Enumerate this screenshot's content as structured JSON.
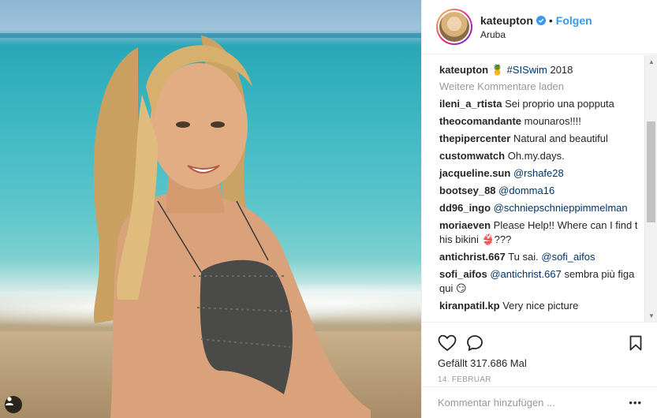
{
  "post": {
    "username": "kateupton",
    "separator": "•",
    "follow_label": "Folgen",
    "location": "Aruba",
    "caption": {
      "emoji": "🍍",
      "hashtag": "#SISwim",
      "text": " 2018"
    },
    "load_more_label": "Weitere Kommentare laden",
    "comments": [
      {
        "user": "ileni_a_rtista",
        "text": "Sei proprio una popputa"
      },
      {
        "user": "theocomandante",
        "text": "mounaros!!!!"
      },
      {
        "user": "thepipercenter",
        "text": "Natural and beautiful"
      },
      {
        "user": "customwatch",
        "text": "Oh.my.days."
      },
      {
        "user": "jacqueline.sun",
        "mention": "@rshafe28"
      },
      {
        "user": "bootsey_88",
        "mention": "@domma16"
      },
      {
        "user": "dd96_ingo",
        "mention": "@schniepschnieppimmelman"
      },
      {
        "user": "moriaeven",
        "text": "Please Help!! Where can I find this bikini 👙???"
      },
      {
        "user": "antichrist.667",
        "text": "Tu sai. ",
        "mention": "@sofi_aifos"
      },
      {
        "user": "sofi_aifos",
        "mention": "@antichrist.667",
        "text": " sembra più figa qui 😏"
      },
      {
        "user": "kiranpatil.kp",
        "text": "Very nice picture"
      }
    ],
    "likes_text": "Gefällt 317.686 Mal",
    "date_text": "14. FEBRUAR",
    "comment_placeholder": "Kommentar hinzufügen ...",
    "more_label": "•••"
  },
  "icons": {
    "verified": "verified-badge-icon",
    "like": "heart-icon",
    "comment": "speech-bubble-icon",
    "save": "bookmark-icon",
    "user_tag": "person-tag-icon",
    "scroll_up": "scroll-up-arrow",
    "scroll_down": "scroll-down-arrow"
  },
  "colors": {
    "link_blue": "#3897f0",
    "mention_blue": "#003569",
    "muted_gray": "#999999",
    "text": "#262626"
  }
}
